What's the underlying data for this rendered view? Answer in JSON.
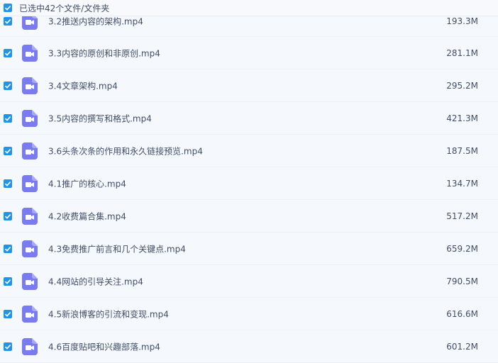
{
  "header": {
    "selection_text": "已选中42个文件/文件夹"
  },
  "colors": {
    "accent": "#1f95e8",
    "video_icon": "#7b7bf0",
    "row_bg": "#f5f9fe"
  },
  "files": [
    {
      "name": "3.2推送内容的架构.mp4",
      "size": "193.3M"
    },
    {
      "name": "3.3内容的原创和非原创.mp4",
      "size": "281.1M"
    },
    {
      "name": "3.4文章架构.mp4",
      "size": "295.2M"
    },
    {
      "name": "3.5内容的撰写和格式.mp4",
      "size": "421.3M"
    },
    {
      "name": "3.6头条次条的作用和永久链接预览.mp4",
      "size": "187.5M"
    },
    {
      "name": "4.1推广的核心.mp4",
      "size": "134.7M"
    },
    {
      "name": "4.2收费篇合集.mp4",
      "size": "517.2M"
    },
    {
      "name": "4.3免费推广前言和几个关键点.mp4",
      "size": "659.2M"
    },
    {
      "name": "4.4网站的引导关注.mp4",
      "size": "790.5M"
    },
    {
      "name": "4.5新浪博客的引流和变现.mp4",
      "size": "616.6M"
    },
    {
      "name": "4.6百度贴吧和兴趣部落.mp4",
      "size": "601.2M"
    }
  ]
}
